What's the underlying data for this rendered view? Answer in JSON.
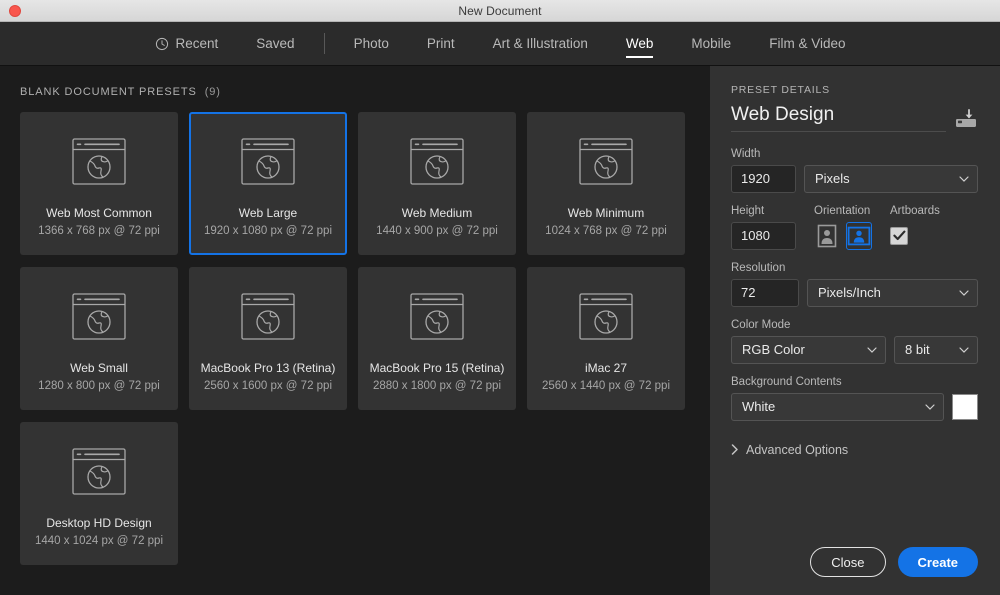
{
  "window": {
    "title": "New Document",
    "close_button": "close"
  },
  "tabs": [
    {
      "label": "Recent",
      "icon": "clock-icon",
      "active": false
    },
    {
      "label": "Saved",
      "icon": "",
      "active": false
    },
    {
      "label": "Photo",
      "icon": "",
      "active": false
    },
    {
      "label": "Print",
      "icon": "",
      "active": false
    },
    {
      "label": "Art & Illustration",
      "icon": "",
      "active": false
    },
    {
      "label": "Web",
      "icon": "",
      "active": true
    },
    {
      "label": "Mobile",
      "icon": "",
      "active": false
    },
    {
      "label": "Film & Video",
      "icon": "",
      "active": false
    }
  ],
  "presets": {
    "header": "BLANK DOCUMENT PRESETS",
    "count": "(9)",
    "items": [
      {
        "name": "Web Most Common",
        "dims": "1366 x 768 px @ 72 ppi",
        "selected": false
      },
      {
        "name": "Web Large",
        "dims": "1920 x 1080 px @ 72 ppi",
        "selected": true
      },
      {
        "name": "Web Medium",
        "dims": "1440 x 900 px @ 72 ppi",
        "selected": false
      },
      {
        "name": "Web Minimum",
        "dims": "1024 x 768 px @ 72 ppi",
        "selected": false
      },
      {
        "name": "Web Small",
        "dims": "1280 x 800 px @ 72 ppi",
        "selected": false
      },
      {
        "name": "MacBook Pro 13 (Retina)",
        "dims": "2560 x 1600 px @ 72 ppi",
        "selected": false
      },
      {
        "name": "MacBook Pro 15 (Retina)",
        "dims": "2880 x 1800 px @ 72 ppi",
        "selected": false
      },
      {
        "name": "iMac 27",
        "dims": "2560 x 1440 px @ 72 ppi",
        "selected": false
      },
      {
        "name": "Desktop HD Design",
        "dims": "1440 x 1024 px @ 72 ppi",
        "selected": false
      }
    ]
  },
  "details": {
    "section_label": "PRESET DETAILS",
    "preset_name": "Web Design",
    "save_preset_icon": "save-preset-icon",
    "width": {
      "label": "Width",
      "value": "1920",
      "unit": "Pixels"
    },
    "height": {
      "label": "Height",
      "value": "1080"
    },
    "orientation": {
      "label": "Orientation",
      "portrait": "portrait-icon",
      "landscape": "landscape-icon",
      "selected": "landscape"
    },
    "artboards": {
      "label": "Artboards",
      "checked": true
    },
    "resolution": {
      "label": "Resolution",
      "value": "72",
      "unit": "Pixels/Inch"
    },
    "color_mode": {
      "label": "Color Mode",
      "value": "RGB Color",
      "depth": "8 bit"
    },
    "background": {
      "label": "Background Contents",
      "value": "White",
      "swatch_color": "#ffffff"
    },
    "advanced": {
      "label": "Advanced Options",
      "expanded": false
    }
  },
  "buttons": {
    "close": "Close",
    "create": "Create"
  },
  "colors": {
    "accent": "#1473e6",
    "panel_bg": "#323232",
    "main_bg": "#1c1c1c",
    "tabbar_bg": "#2b2b2b",
    "card_bg": "#333333"
  }
}
